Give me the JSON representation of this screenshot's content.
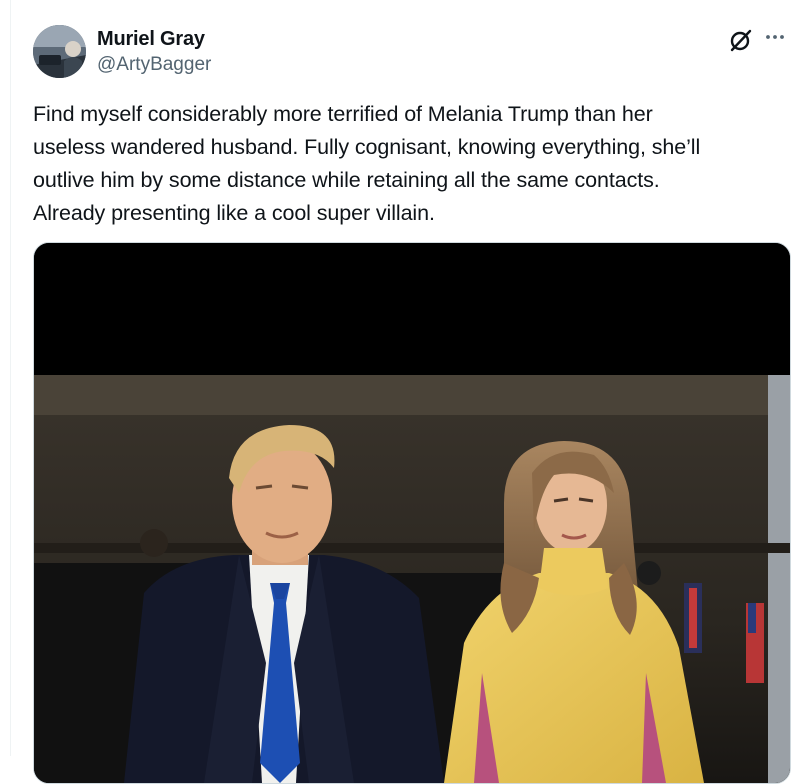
{
  "tweet": {
    "author": {
      "display_name": "Muriel Gray",
      "handle": "@ArtyBagger"
    },
    "text_lines": [
      "Find myself considerably more terrified of Melania Trump than her",
      "useless wandered husband. Fully cognisant, knowing everything, she’ll",
      "outlive him by some distance while retaining all the same contacts.",
      "Already presenting like a cool super villain."
    ],
    "icons": {
      "grok": "grok-slash-circle-icon",
      "more": "more-dots-icon"
    },
    "media": {
      "type": "photo"
    }
  },
  "colors": {
    "text_primary": "#0f1419",
    "text_secondary": "#536471",
    "border": "#cfd9de",
    "dress_yellow": "#e9c65a",
    "tie_blue": "#1d4fb3"
  }
}
